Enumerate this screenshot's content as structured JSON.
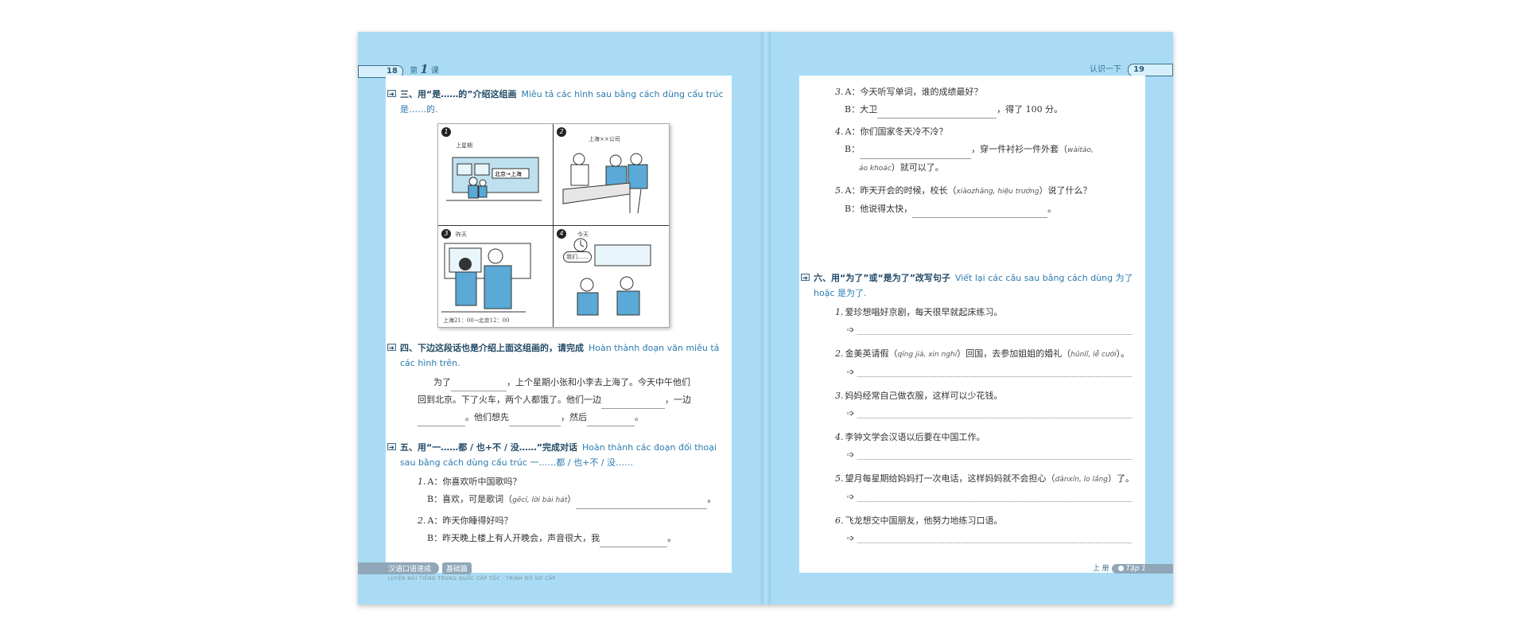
{
  "left_header": {
    "page_number": "18",
    "lesson_prefix": "第",
    "lesson_number": "1",
    "lesson_suffix": "课"
  },
  "right_header": {
    "title": "认识一下",
    "page_number": "19"
  },
  "section3": {
    "title": "三、用“是……的”介绍这组画",
    "vi": "Miêu tả các hình sau bằng cách dùng cấu trúc 是……的.",
    "figure": {
      "p1_label": "上星期",
      "p2_label": "上海××公司",
      "p3_label": "昨天",
      "p3_caption": "上海21：00→北京12：00",
      "p4_label": "今天",
      "p4_bubble1": "我们……",
      "p4_bubble2": "……"
    }
  },
  "section4": {
    "title": "四、下边这段话也是介绍上面这组画的，请完成",
    "vi": "Hoàn thành đoạn văn miêu tả các hình trên.",
    "line1a": "为了",
    "line1b": "，上个星期小张和小李去上海了。今天中午他们",
    "line2": "回到北京。下了火车，两个人都饿了。他们一边",
    "line2b": "，一边",
    "line3a": "。他们想先",
    "line3b": "，然后",
    "line3c": "。"
  },
  "section5": {
    "title": "五、用“一……都 / 也+不 / 没……”完成对话",
    "vi": "Hoàn thành các đoạn đối thoại sau bằng cách dùng cấu trúc 一……都 / 也+不 / 没……",
    "q1_num": "1.",
    "q1_a": "A：你喜欢听中国歌吗？",
    "q1_b_pre": "B：喜欢，可是歌词（",
    "q1_b_pin": "gēcí, lời bài hát",
    "q1_b_post": "）",
    "q2_num": "2.",
    "q2_a": "A：昨天你睡得好吗？",
    "q2_b": "B：昨天晚上楼上有人开晚会，声音很大，我"
  },
  "right_items": {
    "q3_num": "3.",
    "q3_a": "A：今天听写单词，谁的成绩最好？",
    "q3_b_pre": "B：大卫",
    "q3_b_post": "，得了 100 分。",
    "q4_num": "4.",
    "q4_a": "A：你们国家冬天冷不冷？",
    "q4_b_pre": "B：",
    "q4_b_mid": "，穿一件衬衫一件外套（",
    "q4_b_pin1": "wàitào,",
    "q4_b_pin2": "áo khoác",
    "q4_b_post": "）就可以了。",
    "q5_num": "5.",
    "q5_a_pre": "A：昨天开会的时候，校长（",
    "q5_a_pin": "xiàozhǎng, hiệu trưởng",
    "q5_a_post": "）说了什么？",
    "q5_b": "B：他说得太快，"
  },
  "section6": {
    "title": "六、用“为了”或“是为了”改写句子",
    "vi": "Viết lại các câu sau bằng cách dùng 为了 hoặc 是为了.",
    "items": [
      {
        "num": "1.",
        "text": "爱珍想唱好京剧，每天很早就起床练习。"
      },
      {
        "num": "2.",
        "text": "金美英请假（",
        "pin": "qǐng jià, xin nghỉ",
        "text2": "）回国，去参加姐姐的婚礼（",
        "pin2": "hūnlǐ, lễ cưới",
        "text3": "）。"
      },
      {
        "num": "3.",
        "text": "妈妈经常自己做衣服，这样可以少花钱。"
      },
      {
        "num": "4.",
        "text": "李钟文学会汉语以后要在中国工作。"
      },
      {
        "num": "5.",
        "text": "望月每星期给妈妈打一次电话，这样妈妈就不会担心（",
        "pin": "dānxīn, lo lắng",
        "text2": "）了。"
      },
      {
        "num": "6.",
        "text": "飞龙想交中国朋友，他努力地练习口语。"
      }
    ]
  },
  "left_footer": {
    "band": "汉语口语速成",
    "sub": "基础篇",
    "tiny": "LUYỆN NÓI TIẾNG TRUNG QUỐC CẤP TỐC · TRÌNH ĐỘ SƠ CẤP"
  },
  "right_footer": {
    "vol": "上 册",
    "badge": "Tập 1"
  },
  "colors": {
    "page_bg": "#a9dcf4",
    "heading": "#224a66",
    "vi_text": "#2b7bb0"
  }
}
